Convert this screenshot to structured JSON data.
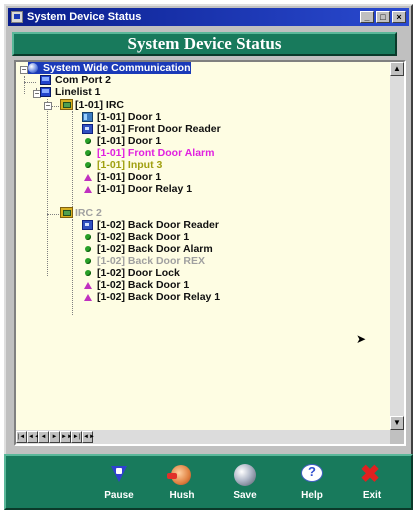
{
  "window": {
    "title": "System Device Status",
    "min_label": "_",
    "max_label": "□",
    "close_label": "×"
  },
  "header": {
    "title": "System Device Status"
  },
  "tree": {
    "root": {
      "label": "System Wide Communication",
      "icon": "globe-icon"
    },
    "nodes": [
      {
        "label": "Com Port 2",
        "icon": "monitor-icon",
        "color": "#101010"
      },
      {
        "label": "Linelist 1",
        "icon": "monitor-icon",
        "color": "#101010"
      },
      {
        "label": "[1-01] IRC",
        "icon": "folder-icon",
        "color": "#e02020"
      },
      {
        "label": "[1-01] Door 1",
        "icon": "door-icon",
        "color": "#101010"
      },
      {
        "label": "[1-01] Front Door Reader",
        "icon": "reader-icon",
        "color": "#101010"
      },
      {
        "label": "[1-01] Door 1",
        "icon": "status-dot-icon",
        "color": "#101010"
      },
      {
        "label": "[1-01] Front Door Alarm",
        "icon": "status-dot-icon",
        "color": "#e020e0"
      },
      {
        "label": "[1-01] Input 3",
        "icon": "status-dot-icon",
        "color": "#a0a010"
      },
      {
        "label": "[1-01] Door 1",
        "icon": "relay-icon",
        "color": "#101010"
      },
      {
        "label": "[1-01] Door Relay 1",
        "icon": "relay-icon",
        "color": "#101010"
      },
      {
        "label": "IRC 2",
        "icon": "folder-icon",
        "color": "#a0a0a0"
      },
      {
        "label": "[1-02] Back Door Reader",
        "icon": "reader-icon",
        "color": "#101010"
      },
      {
        "label": "[1-02] Back Door 1",
        "icon": "status-dot-icon",
        "color": "#101010"
      },
      {
        "label": "[1-02] Back Door Alarm",
        "icon": "status-dot-icon",
        "color": "#101010"
      },
      {
        "label": "[1-02] Back Door REX",
        "icon": "status-dot-icon",
        "color": "#a0a0a0"
      },
      {
        "label": "[1-02] Door Lock",
        "icon": "status-dot-icon",
        "color": "#101010"
      },
      {
        "label": "[1-02] Back Door 1",
        "icon": "relay-icon",
        "color": "#101010"
      },
      {
        "label": "[1-02] Back Door Relay 1",
        "icon": "relay-icon",
        "color": "#101010"
      }
    ]
  },
  "nav_buttons": [
    "|◄",
    "◄◄",
    "◄",
    "►",
    "►►",
    "►|",
    "◄►"
  ],
  "toolbar": {
    "buttons": [
      {
        "label": "Pause",
        "icon": "pause-icon"
      },
      {
        "label": "Hush",
        "icon": "hush-icon"
      },
      {
        "label": "Save",
        "icon": "save-icon"
      },
      {
        "label": "Help",
        "icon": "help-icon"
      },
      {
        "label": "Exit",
        "icon": "exit-icon"
      }
    ]
  },
  "colors": {
    "accent": "#187a5c",
    "tree_background": "#fefde3",
    "title_bar": "#0a1e8c"
  }
}
